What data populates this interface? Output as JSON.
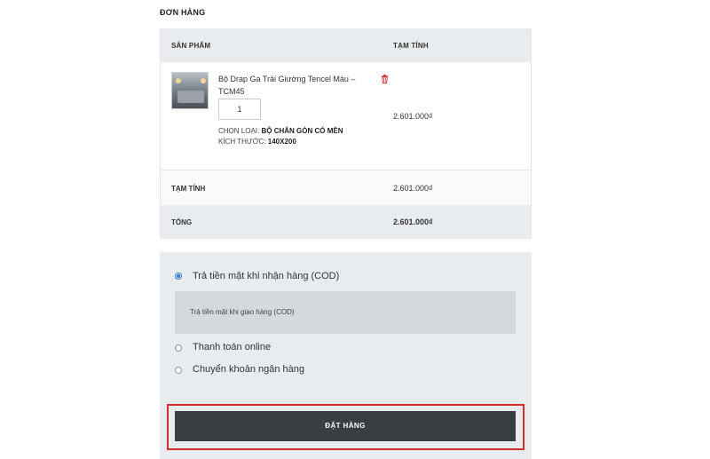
{
  "order": {
    "heading": "ĐƠN HÀNG",
    "table": {
      "col_product": "SẢN PHẨM",
      "col_subtotal": "TẠM TÍNH"
    },
    "item": {
      "name": "Bộ Drap Ga Trải Giường Tencel Màu – TCM45",
      "quantity": "1",
      "attr_type_label": "CHỌN LOẠI:",
      "attr_type_value": "BỘ CHĂN GÒN CÓ MỀN",
      "attr_size_label": "KÍCH THƯỚC:",
      "attr_size_value": "140X200",
      "price": "2.601.000₫",
      "remove_icon": "trash-icon"
    },
    "subtotal_label": "TẠM TÍNH",
    "subtotal_value": "2.601.000₫",
    "total_label": "TỔNG",
    "total_value": "2.601.000₫"
  },
  "payment": {
    "options": [
      {
        "label": "Trả tiền mặt khi nhận hàng (COD)",
        "selected": true
      },
      {
        "label": "Thanh toán online",
        "selected": false
      },
      {
        "label": "Chuyển khoản ngân hàng",
        "selected": false
      }
    ],
    "cod_description": "Trả tiền mặt khi giao hàng (COD)"
  },
  "checkout": {
    "place_order_label": "ĐẶT HÀNG",
    "highlight_color": "#d32f2f",
    "button_color": "#3a3d42"
  }
}
